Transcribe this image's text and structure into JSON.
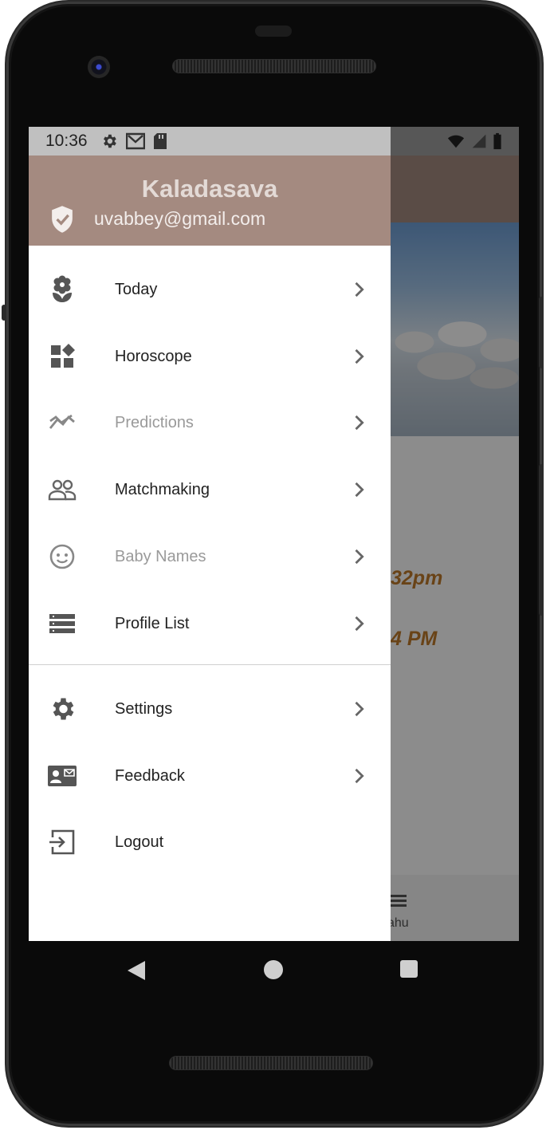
{
  "status_bar": {
    "time": "10:36"
  },
  "drawer": {
    "header": {
      "name": "Kaladasava",
      "email": "uvabbey@gmail.com"
    },
    "items": [
      {
        "label": "Today",
        "icon": "flower-icon",
        "disabled": false,
        "chevron": true
      },
      {
        "label": "Horoscope",
        "icon": "widgets-icon",
        "disabled": false,
        "chevron": true
      },
      {
        "label": "Predictions",
        "icon": "trending-icon",
        "disabled": true,
        "chevron": true
      },
      {
        "label": "Matchmaking",
        "icon": "people-icon",
        "disabled": false,
        "chevron": true
      },
      {
        "label": "Baby Names",
        "icon": "face-icon",
        "disabled": true,
        "chevron": true
      },
      {
        "label": "Profile List",
        "icon": "list-icon",
        "disabled": false,
        "chevron": true
      }
    ],
    "secondary_items": [
      {
        "label": "Settings",
        "icon": "gear-icon",
        "chevron": true
      },
      {
        "label": "Feedback",
        "icon": "contact-mail-icon",
        "chevron": true
      },
      {
        "label": "Logout",
        "icon": "logout-icon",
        "chevron": false
      }
    ]
  },
  "background_app": {
    "time_1": "32pm",
    "time_2": "4 PM",
    "nav_label": "ahu"
  },
  "colors": {
    "header": "#a48a80",
    "accent_text": "#c07a2a",
    "disabled_text": "#9a9a9a"
  }
}
